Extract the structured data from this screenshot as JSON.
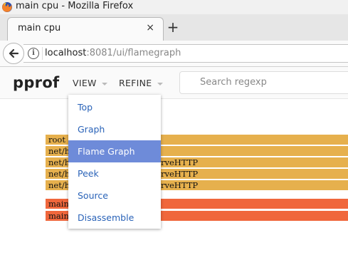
{
  "window": {
    "title": "main cpu - Mozilla Firefox"
  },
  "tab": {
    "label": "main cpu",
    "close_glyph": "×",
    "new_tab_glyph": "+"
  },
  "nav": {
    "url_host": "localhost",
    "url_rest": ":8081/ui/flamegraph",
    "info_glyph": "i"
  },
  "pprof": {
    "logo": "pprof",
    "menus": {
      "view": "VIEW",
      "refine": "REFINE"
    },
    "search_placeholder": "Search regexp"
  },
  "flamegraph": {
    "frames": [
      {
        "left": "root",
        "right": ""
      },
      {
        "left": "net/h",
        "right": ""
      },
      {
        "left": "net/h",
        "right": "rveHTTP"
      },
      {
        "left": "net/h",
        "right": "rveHTTP"
      },
      {
        "left": "net/h",
        "right": "rveHTTP"
      },
      {
        "left": "main",
        "right": ""
      },
      {
        "left": "main",
        "right": ""
      }
    ],
    "colors": {
      "go_frame": "#e6b04d",
      "main_frame": "#f0673c"
    }
  },
  "view_menu": {
    "items": [
      "Top",
      "Graph",
      "Flame Graph",
      "Peek",
      "Source",
      "Disassemble"
    ],
    "selected": "Flame Graph",
    "colors": {
      "link": "#2a63b8",
      "selected_bg": "#6e8bd9"
    }
  }
}
